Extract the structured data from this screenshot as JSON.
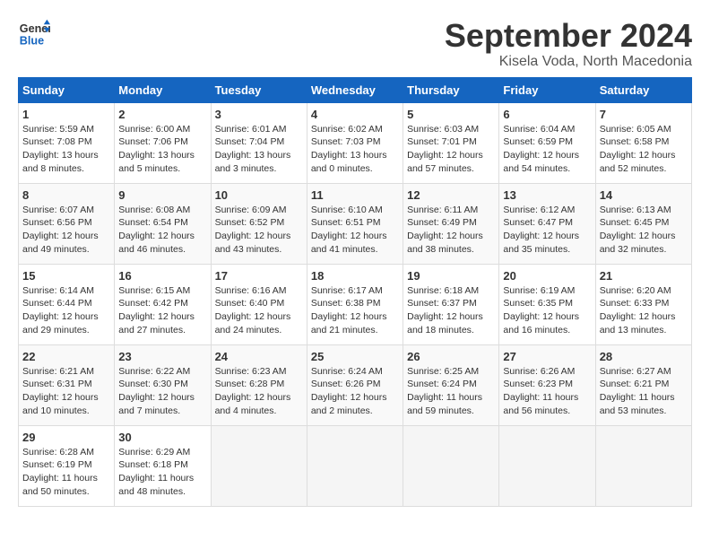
{
  "logo": {
    "line1": "General",
    "line2": "Blue"
  },
  "title": "September 2024",
  "subtitle": "Kisela Voda, North Macedonia",
  "days_of_week": [
    "Sunday",
    "Monday",
    "Tuesday",
    "Wednesday",
    "Thursday",
    "Friday",
    "Saturday"
  ],
  "weeks": [
    [
      {
        "day": 1,
        "sunrise": "5:59 AM",
        "sunset": "7:08 PM",
        "daylight": "13 hours and 8 minutes"
      },
      {
        "day": 2,
        "sunrise": "6:00 AM",
        "sunset": "7:06 PM",
        "daylight": "13 hours and 5 minutes"
      },
      {
        "day": 3,
        "sunrise": "6:01 AM",
        "sunset": "7:04 PM",
        "daylight": "13 hours and 3 minutes"
      },
      {
        "day": 4,
        "sunrise": "6:02 AM",
        "sunset": "7:03 PM",
        "daylight": "13 hours and 0 minutes"
      },
      {
        "day": 5,
        "sunrise": "6:03 AM",
        "sunset": "7:01 PM",
        "daylight": "12 hours and 57 minutes"
      },
      {
        "day": 6,
        "sunrise": "6:04 AM",
        "sunset": "6:59 PM",
        "daylight": "12 hours and 54 minutes"
      },
      {
        "day": 7,
        "sunrise": "6:05 AM",
        "sunset": "6:58 PM",
        "daylight": "12 hours and 52 minutes"
      }
    ],
    [
      {
        "day": 8,
        "sunrise": "6:07 AM",
        "sunset": "6:56 PM",
        "daylight": "12 hours and 49 minutes"
      },
      {
        "day": 9,
        "sunrise": "6:08 AM",
        "sunset": "6:54 PM",
        "daylight": "12 hours and 46 minutes"
      },
      {
        "day": 10,
        "sunrise": "6:09 AM",
        "sunset": "6:52 PM",
        "daylight": "12 hours and 43 minutes"
      },
      {
        "day": 11,
        "sunrise": "6:10 AM",
        "sunset": "6:51 PM",
        "daylight": "12 hours and 41 minutes"
      },
      {
        "day": 12,
        "sunrise": "6:11 AM",
        "sunset": "6:49 PM",
        "daylight": "12 hours and 38 minutes"
      },
      {
        "day": 13,
        "sunrise": "6:12 AM",
        "sunset": "6:47 PM",
        "daylight": "12 hours and 35 minutes"
      },
      {
        "day": 14,
        "sunrise": "6:13 AM",
        "sunset": "6:45 PM",
        "daylight": "12 hours and 32 minutes"
      }
    ],
    [
      {
        "day": 15,
        "sunrise": "6:14 AM",
        "sunset": "6:44 PM",
        "daylight": "12 hours and 29 minutes"
      },
      {
        "day": 16,
        "sunrise": "6:15 AM",
        "sunset": "6:42 PM",
        "daylight": "12 hours and 27 minutes"
      },
      {
        "day": 17,
        "sunrise": "6:16 AM",
        "sunset": "6:40 PM",
        "daylight": "12 hours and 24 minutes"
      },
      {
        "day": 18,
        "sunrise": "6:17 AM",
        "sunset": "6:38 PM",
        "daylight": "12 hours and 21 minutes"
      },
      {
        "day": 19,
        "sunrise": "6:18 AM",
        "sunset": "6:37 PM",
        "daylight": "12 hours and 18 minutes"
      },
      {
        "day": 20,
        "sunrise": "6:19 AM",
        "sunset": "6:35 PM",
        "daylight": "12 hours and 16 minutes"
      },
      {
        "day": 21,
        "sunrise": "6:20 AM",
        "sunset": "6:33 PM",
        "daylight": "12 hours and 13 minutes"
      }
    ],
    [
      {
        "day": 22,
        "sunrise": "6:21 AM",
        "sunset": "6:31 PM",
        "daylight": "12 hours and 10 minutes"
      },
      {
        "day": 23,
        "sunrise": "6:22 AM",
        "sunset": "6:30 PM",
        "daylight": "12 hours and 7 minutes"
      },
      {
        "day": 24,
        "sunrise": "6:23 AM",
        "sunset": "6:28 PM",
        "daylight": "12 hours and 4 minutes"
      },
      {
        "day": 25,
        "sunrise": "6:24 AM",
        "sunset": "6:26 PM",
        "daylight": "12 hours and 2 minutes"
      },
      {
        "day": 26,
        "sunrise": "6:25 AM",
        "sunset": "6:24 PM",
        "daylight": "11 hours and 59 minutes"
      },
      {
        "day": 27,
        "sunrise": "6:26 AM",
        "sunset": "6:23 PM",
        "daylight": "11 hours and 56 minutes"
      },
      {
        "day": 28,
        "sunrise": "6:27 AM",
        "sunset": "6:21 PM",
        "daylight": "11 hours and 53 minutes"
      }
    ],
    [
      {
        "day": 29,
        "sunrise": "6:28 AM",
        "sunset": "6:19 PM",
        "daylight": "11 hours and 50 minutes"
      },
      {
        "day": 30,
        "sunrise": "6:29 AM",
        "sunset": "6:18 PM",
        "daylight": "11 hours and 48 minutes"
      },
      null,
      null,
      null,
      null,
      null
    ]
  ]
}
